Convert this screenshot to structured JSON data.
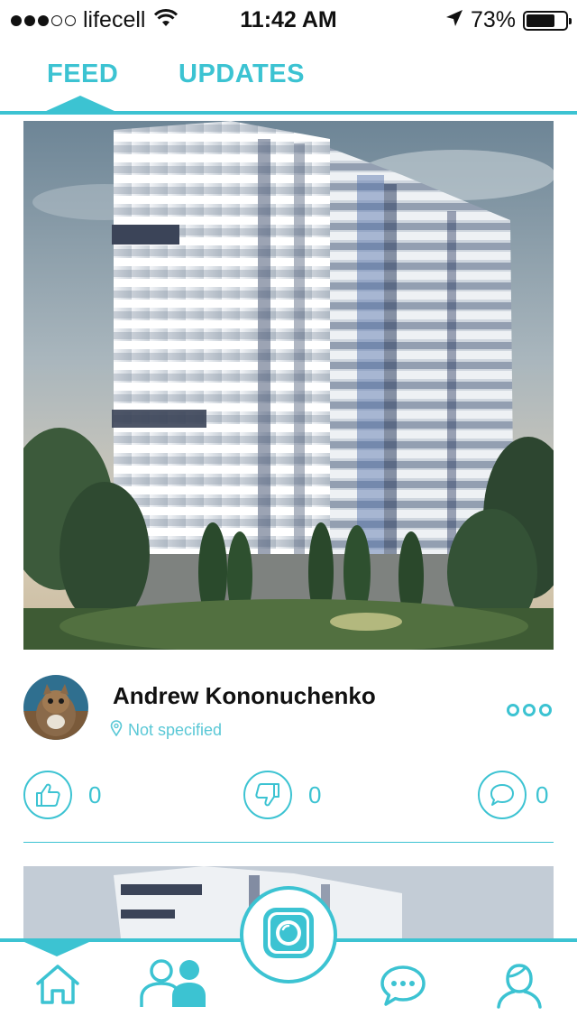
{
  "status_bar": {
    "carrier": "lifecell",
    "signal_bars_filled": 3,
    "signal_bars_total": 5,
    "time": "11:42 AM",
    "battery_percent": "73%",
    "battery_level": 0.73,
    "icons": [
      "wifi-icon",
      "location-arrow-icon",
      "battery-icon"
    ]
  },
  "tabs": [
    {
      "label": "FEED",
      "active": true
    },
    {
      "label": "UPDATES",
      "active": false
    }
  ],
  "post": {
    "image": "building-photo",
    "author": "Andrew Kononuchenko",
    "location": "Not specified",
    "likes": "0",
    "dislikes": "0",
    "comments": "0"
  },
  "bottom_nav": {
    "items": [
      "home-icon",
      "people-icon",
      "camera-icon",
      "chat-icon",
      "profile-icon"
    ],
    "active": "home"
  },
  "colors": {
    "accent": "#3cc3d2",
    "text": "#111111",
    "background": "#ffffff"
  }
}
